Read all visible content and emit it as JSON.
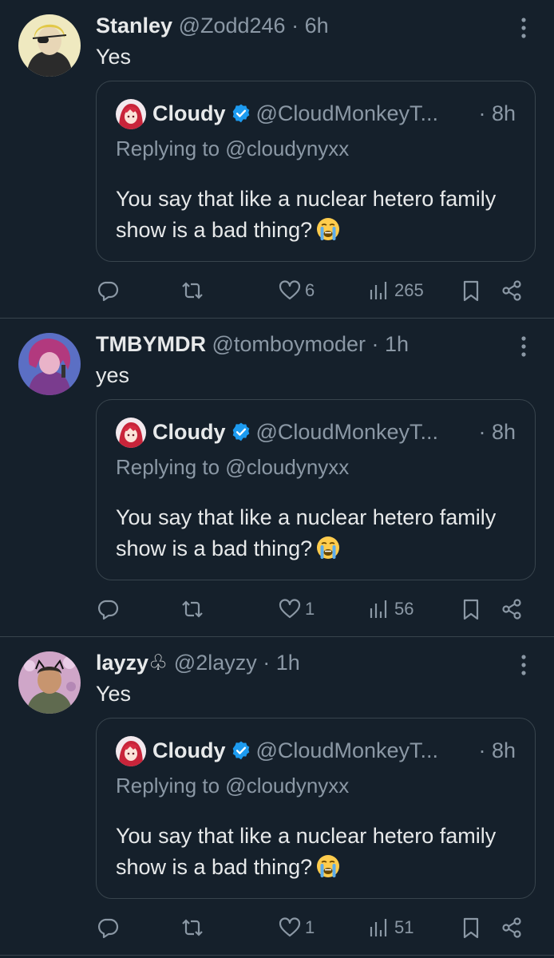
{
  "tweets": [
    {
      "name": "Stanley",
      "handle": "@Zodd246",
      "dot": "·",
      "time": "6h",
      "text": "Yes",
      "avatar": "stanley-avatar",
      "quote": {
        "name": "Cloudy",
        "handle": "@CloudMonkeyT...",
        "time": "· 8h",
        "replying": "Replying to @cloudynyxx",
        "text": "You say that like a nuclear hetero family show is a bad thing?"
      },
      "likes": "6",
      "views": "265"
    },
    {
      "name": "TMBYMDR",
      "handle": "@tomboymoder",
      "dot": "·",
      "time": "1h",
      "text": "yes",
      "avatar": "tmbymdr-avatar",
      "quote": {
        "name": "Cloudy",
        "handle": "@CloudMonkeyT...",
        "time": "· 8h",
        "replying": "Replying to @cloudynyxx",
        "text": "You say that like a nuclear hetero family show is a bad thing?"
      },
      "likes": "1",
      "views": "56"
    },
    {
      "name": "layzy♧",
      "handle": "@2layzy",
      "dot": "·",
      "time": "1h",
      "text": "Yes",
      "avatar": "layzy-avatar",
      "quote": {
        "name": "Cloudy",
        "handle": "@CloudMonkeyT...",
        "time": "· 8h",
        "replying": "Replying to @cloudynyxx",
        "text": "You say that like a nuclear hetero family show is a bad thing?"
      },
      "likes": "1",
      "views": "51"
    }
  ],
  "icons": [
    "reply-icon",
    "retweet-icon",
    "like-icon",
    "views-icon",
    "bookmark-icon",
    "share-icon",
    "more-icon",
    "verified-icon",
    "crying-emoji"
  ],
  "colors": {
    "background": "#15202b",
    "text": "#e7e9ea",
    "muted": "#8b98a5",
    "border": "#38444d",
    "verified": "#1d9bf0"
  }
}
